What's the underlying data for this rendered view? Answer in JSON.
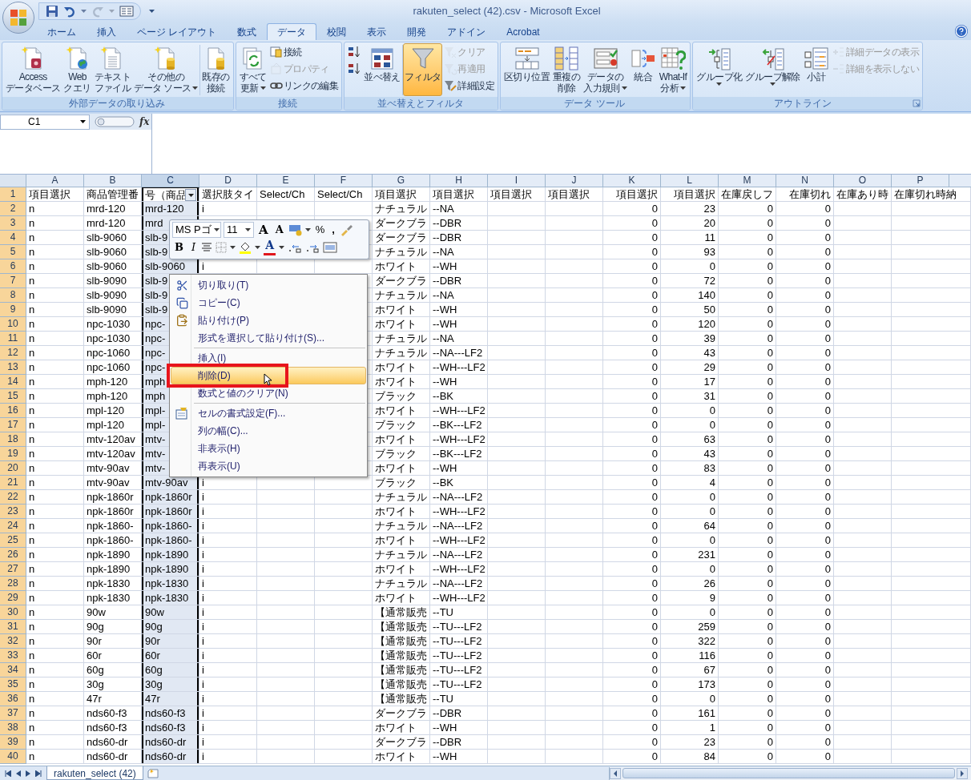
{
  "window": {
    "title": "rakuten_select (42).csv - Microsoft Excel"
  },
  "ribbon_tabs": [
    {
      "label": "ホーム",
      "selected": false
    },
    {
      "label": "挿入",
      "selected": false
    },
    {
      "label": "ページ レイアウト",
      "selected": false
    },
    {
      "label": "数式",
      "selected": false
    },
    {
      "label": "データ",
      "selected": true
    },
    {
      "label": "校閲",
      "selected": false
    },
    {
      "label": "表示",
      "selected": false
    },
    {
      "label": "開発",
      "selected": false
    },
    {
      "label": "アドイン",
      "selected": false
    },
    {
      "label": "Acrobat",
      "selected": false
    }
  ],
  "ribbon_groups": [
    {
      "title": "外部データの取り込み",
      "launcher": false,
      "buttons": [
        {
          "kind": "large",
          "lines": [
            "Access",
            "データベース"
          ],
          "dropdown": false,
          "on": false,
          "disabled": false
        },
        {
          "kind": "large",
          "lines": [
            "Web",
            "クエリ"
          ],
          "dropdown": false,
          "on": false,
          "disabled": false
        },
        {
          "kind": "large",
          "lines": [
            "テキスト",
            "ファイル"
          ],
          "dropdown": false,
          "on": false,
          "disabled": false
        },
        {
          "kind": "large",
          "lines": [
            "その他の",
            "データ ソース"
          ],
          "dropdown": true,
          "on": false,
          "disabled": false
        },
        {
          "kind": "separator"
        },
        {
          "kind": "large",
          "lines": [
            "既存の",
            "接続"
          ],
          "dropdown": false,
          "on": false,
          "disabled": false
        }
      ]
    },
    {
      "title": "接続",
      "launcher": false,
      "buttons": [
        {
          "kind": "large",
          "lines": [
            "すべて",
            "更新"
          ],
          "dropdown": true,
          "on": false,
          "disabled": false
        },
        {
          "kind": "small",
          "label": "接続",
          "dropdown": false,
          "on": false,
          "disabled": false
        },
        {
          "kind": "small",
          "label": "プロパティ",
          "dropdown": false,
          "on": false,
          "disabled": true
        },
        {
          "kind": "small",
          "label": "リンクの編集",
          "dropdown": false,
          "on": false,
          "disabled": false
        }
      ]
    },
    {
      "title": "並べ替えとフィルタ",
      "launcher": false,
      "buttons": [
        {
          "kind": "icon",
          "dropdown": false,
          "on": false,
          "disabled": false
        },
        {
          "kind": "icon",
          "dropdown": false,
          "on": false,
          "disabled": false
        },
        {
          "kind": "large",
          "lines": [
            "並べ替え"
          ],
          "dropdown": false,
          "on": false,
          "disabled": false
        },
        {
          "kind": "separator"
        },
        {
          "kind": "large",
          "lines": [
            "フィルタ"
          ],
          "dropdown": false,
          "on": true,
          "disabled": false
        },
        {
          "kind": "small",
          "label": "クリア",
          "dropdown": false,
          "on": false,
          "disabled": true
        },
        {
          "kind": "small",
          "label": "再適用",
          "dropdown": false,
          "on": false,
          "disabled": true
        },
        {
          "kind": "small",
          "label": "詳細設定",
          "dropdown": false,
          "on": false,
          "disabled": false
        }
      ]
    },
    {
      "title": "データ ツール",
      "launcher": false,
      "buttons": [
        {
          "kind": "large",
          "lines": [
            "区切り位置"
          ],
          "dropdown": false,
          "on": false,
          "disabled": false
        },
        {
          "kind": "large",
          "lines": [
            "重複の",
            "削除"
          ],
          "dropdown": false,
          "on": false,
          "disabled": false
        },
        {
          "kind": "large",
          "lines": [
            "データの",
            "入力規則"
          ],
          "dropdown": true,
          "on": false,
          "disabled": false
        },
        {
          "kind": "large",
          "lines": [
            "統合"
          ],
          "dropdown": false,
          "on": false,
          "disabled": false
        },
        {
          "kind": "large",
          "lines": [
            "What-If",
            "分析"
          ],
          "dropdown": true,
          "on": false,
          "disabled": false
        }
      ]
    },
    {
      "title": "アウトライン",
      "launcher": true,
      "buttons": [
        {
          "kind": "large",
          "lines": [
            "グループ化"
          ],
          "dropdown": true,
          "on": false,
          "disabled": false
        },
        {
          "kind": "large",
          "lines": [
            "グループ解除"
          ],
          "dropdown": true,
          "on": false,
          "disabled": false
        },
        {
          "kind": "large",
          "lines": [
            "小計"
          ],
          "dropdown": false,
          "on": false,
          "disabled": false
        },
        {
          "kind": "small",
          "label": "詳細データの表示",
          "dropdown": false,
          "on": false,
          "disabled": true
        },
        {
          "kind": "small",
          "label": "詳細を表示しない",
          "dropdown": false,
          "on": false,
          "disabled": true
        }
      ]
    }
  ],
  "formula_bar": {
    "name_box": "C1",
    "fx": "fx"
  },
  "sheet": {
    "active_cell_dropdown": true,
    "columns": [
      {
        "label": "A",
        "selected": false
      },
      {
        "label": "B",
        "selected": false
      },
      {
        "label": "C",
        "selected": true
      },
      {
        "label": "D",
        "selected": false
      },
      {
        "label": "E",
        "selected": false
      },
      {
        "label": "F",
        "selected": false
      },
      {
        "label": "G",
        "selected": false
      },
      {
        "label": "H",
        "selected": false
      },
      {
        "label": "I",
        "selected": false
      },
      {
        "label": "J",
        "selected": false
      },
      {
        "label": "K",
        "selected": false
      },
      {
        "label": "L",
        "selected": false
      },
      {
        "label": "M",
        "selected": false
      },
      {
        "label": "N",
        "selected": false
      },
      {
        "label": "O",
        "selected": false
      },
      {
        "label": "P",
        "selected": false
      }
    ],
    "rows": [
      {
        "number": "1",
        "cells": [
          "項目選択",
          "商品管理番",
          "号（商品",
          "選択肢タイ",
          "Select/Ch",
          "Select/Ch",
          "項目選択",
          "項目選択",
          "項目選択",
          "項目選択",
          "項目選択",
          "項目選択",
          "在庫戻しフ",
          "在庫切れ",
          "在庫あり時",
          "在庫切れ時納"
        ]
      },
      {
        "number": "2",
        "cells": [
          "n",
          "mrd-120",
          "mrd-120",
          "i",
          null,
          null,
          "ナチュラル",
          "--NA",
          null,
          null,
          "0",
          "23",
          "0",
          "0",
          null,
          null
        ]
      },
      {
        "number": "3",
        "cells": [
          "n",
          "mrd-120",
          "mrd",
          null,
          null,
          null,
          "ダークブラ",
          "--DBR",
          null,
          null,
          "0",
          "20",
          "0",
          "0",
          null,
          null
        ]
      },
      {
        "number": "4",
        "cells": [
          "n",
          "slb-9060",
          "slb-9",
          null,
          null,
          null,
          "ダークブラ",
          "--DBR",
          null,
          null,
          "0",
          "11",
          "0",
          "0",
          null,
          null
        ]
      },
      {
        "number": "5",
        "cells": [
          "n",
          "slb-9060",
          "slb-9",
          null,
          null,
          null,
          "ナチュラル",
          "--NA",
          null,
          null,
          "0",
          "93",
          "0",
          "0",
          null,
          null
        ]
      },
      {
        "number": "6",
        "cells": [
          "n",
          "slb-9060",
          "slb-9060",
          "i",
          null,
          null,
          "ホワイト",
          "--WH",
          null,
          null,
          "0",
          "0",
          "0",
          "0",
          null,
          null
        ]
      },
      {
        "number": "7",
        "cells": [
          "n",
          "slb-9090",
          "slb-9",
          null,
          null,
          null,
          "ダークブラ",
          "--DBR",
          null,
          null,
          "0",
          "72",
          "0",
          "0",
          null,
          null
        ]
      },
      {
        "number": "8",
        "cells": [
          "n",
          "slb-9090",
          "slb-9",
          null,
          null,
          null,
          "ナチュラル",
          "--NA",
          null,
          null,
          "0",
          "140",
          "0",
          "0",
          null,
          null
        ]
      },
      {
        "number": "9",
        "cells": [
          "n",
          "slb-9090",
          "slb-9",
          null,
          null,
          null,
          "ホワイト",
          "--WH",
          null,
          null,
          "0",
          "50",
          "0",
          "0",
          null,
          null
        ]
      },
      {
        "number": "10",
        "cells": [
          "n",
          "npc-1030",
          "npc-",
          null,
          null,
          null,
          "ホワイト",
          "--WH",
          null,
          null,
          "0",
          "120",
          "0",
          "0",
          null,
          null
        ]
      },
      {
        "number": "11",
        "cells": [
          "n",
          "npc-1030",
          "npc-",
          null,
          null,
          null,
          "ナチュラル",
          "--NA",
          null,
          null,
          "0",
          "39",
          "0",
          "0",
          null,
          null
        ]
      },
      {
        "number": "12",
        "cells": [
          "n",
          "npc-1060",
          "npc-",
          null,
          null,
          null,
          "ナチュラル",
          "--NA---LF2",
          null,
          null,
          "0",
          "43",
          "0",
          "0",
          null,
          null
        ]
      },
      {
        "number": "13",
        "cells": [
          "n",
          "npc-1060",
          "npc-",
          null,
          null,
          null,
          "ホワイト",
          "--WH---LF2",
          null,
          null,
          "0",
          "29",
          "0",
          "0",
          null,
          null
        ]
      },
      {
        "number": "14",
        "cells": [
          "n",
          "mph-120",
          "mph",
          null,
          null,
          null,
          "ホワイト",
          "--WH",
          null,
          null,
          "0",
          "17",
          "0",
          "0",
          null,
          null
        ]
      },
      {
        "number": "15",
        "cells": [
          "n",
          "mph-120",
          "mph",
          null,
          null,
          null,
          "ブラック",
          "--BK",
          null,
          null,
          "0",
          "31",
          "0",
          "0",
          null,
          null
        ]
      },
      {
        "number": "16",
        "cells": [
          "n",
          "mpl-120",
          "mpl-",
          null,
          null,
          null,
          "ホワイト",
          "--WH---LF2",
          null,
          null,
          "0",
          "0",
          "0",
          "0",
          null,
          null
        ]
      },
      {
        "number": "17",
        "cells": [
          "n",
          "mpl-120",
          "mpl-",
          null,
          null,
          null,
          "ブラック",
          "--BK---LF2",
          null,
          null,
          "0",
          "0",
          "0",
          "0",
          null,
          null
        ]
      },
      {
        "number": "18",
        "cells": [
          "n",
          "mtv-120av",
          "mtv-",
          null,
          null,
          null,
          "ホワイト",
          "--WH---LF2",
          null,
          null,
          "0",
          "63",
          "0",
          "0",
          null,
          null
        ]
      },
      {
        "number": "19",
        "cells": [
          "n",
          "mtv-120av",
          "mtv-",
          null,
          null,
          null,
          "ブラック",
          "--BK---LF2",
          null,
          null,
          "0",
          "43",
          "0",
          "0",
          null,
          null
        ]
      },
      {
        "number": "20",
        "cells": [
          "n",
          "mtv-90av",
          "mtv-",
          null,
          null,
          null,
          "ホワイト",
          "--WH",
          null,
          null,
          "0",
          "83",
          "0",
          "0",
          null,
          null
        ]
      },
      {
        "number": "21",
        "cells": [
          "n",
          "mtv-90av",
          "mtv-90av",
          "i",
          null,
          null,
          "ブラック",
          "--BK",
          null,
          null,
          "0",
          "4",
          "0",
          "0",
          null,
          null
        ]
      },
      {
        "number": "22",
        "cells": [
          "n",
          "npk-1860r",
          "npk-1860r",
          "i",
          null,
          null,
          "ナチュラル",
          "--NA---LF2",
          null,
          null,
          "0",
          "0",
          "0",
          "0",
          null,
          null
        ]
      },
      {
        "number": "23",
        "cells": [
          "n",
          "npk-1860r",
          "npk-1860r",
          "i",
          null,
          null,
          "ホワイト",
          "--WH---LF2",
          null,
          null,
          "0",
          "0",
          "0",
          "0",
          null,
          null
        ]
      },
      {
        "number": "24",
        "cells": [
          "n",
          "npk-1860-",
          "npk-1860-",
          "i",
          null,
          null,
          "ナチュラル",
          "--NA---LF2",
          null,
          null,
          "0",
          "64",
          "0",
          "0",
          null,
          null
        ]
      },
      {
        "number": "25",
        "cells": [
          "n",
          "npk-1860-",
          "npk-1860-",
          "i",
          null,
          null,
          "ホワイト",
          "--WH---LF2",
          null,
          null,
          "0",
          "0",
          "0",
          "0",
          null,
          null
        ]
      },
      {
        "number": "26",
        "cells": [
          "n",
          "npk-1890",
          "npk-1890",
          "i",
          null,
          null,
          "ナチュラル",
          "--NA---LF2",
          null,
          null,
          "0",
          "231",
          "0",
          "0",
          null,
          null
        ]
      },
      {
        "number": "27",
        "cells": [
          "n",
          "npk-1890",
          "npk-1890",
          "i",
          null,
          null,
          "ホワイト",
          "--WH---LF2",
          null,
          null,
          "0",
          "0",
          "0",
          "0",
          null,
          null
        ]
      },
      {
        "number": "28",
        "cells": [
          "n",
          "npk-1830",
          "npk-1830",
          "i",
          null,
          null,
          "ナチュラル",
          "--NA---LF2",
          null,
          null,
          "0",
          "26",
          "0",
          "0",
          null,
          null
        ]
      },
      {
        "number": "29",
        "cells": [
          "n",
          "npk-1830",
          "npk-1830",
          "i",
          null,
          null,
          "ホワイト",
          "--WH---LF2",
          null,
          null,
          "0",
          "9",
          "0",
          "0",
          null,
          null
        ]
      },
      {
        "number": "30",
        "cells": [
          "n",
          "90w",
          "90w",
          "i",
          null,
          null,
          "【通常販売",
          "--TU",
          null,
          null,
          "0",
          "0",
          "0",
          "0",
          null,
          null
        ]
      },
      {
        "number": "31",
        "cells": [
          "n",
          "90g",
          "90g",
          "i",
          null,
          null,
          "【通常販売",
          "--TU---LF2",
          null,
          null,
          "0",
          "259",
          "0",
          "0",
          null,
          null
        ]
      },
      {
        "number": "32",
        "cells": [
          "n",
          "90r",
          "90r",
          "i",
          null,
          null,
          "【通常販売",
          "--TU---LF2",
          null,
          null,
          "0",
          "322",
          "0",
          "0",
          null,
          null
        ]
      },
      {
        "number": "33",
        "cells": [
          "n",
          "60r",
          "60r",
          "i",
          null,
          null,
          "【通常販売",
          "--TU---LF2",
          null,
          null,
          "0",
          "116",
          "0",
          "0",
          null,
          null
        ]
      },
      {
        "number": "34",
        "cells": [
          "n",
          "60g",
          "60g",
          "i",
          null,
          null,
          "【通常販売",
          "--TU---LF2",
          null,
          null,
          "0",
          "67",
          "0",
          "0",
          null,
          null
        ]
      },
      {
        "number": "35",
        "cells": [
          "n",
          "30g",
          "30g",
          "i",
          null,
          null,
          "【通常販売",
          "--TU---LF2",
          null,
          null,
          "0",
          "173",
          "0",
          "0",
          null,
          null
        ]
      },
      {
        "number": "36",
        "cells": [
          "n",
          "47r",
          "47r",
          "i",
          null,
          null,
          "【通常販売",
          "--TU",
          null,
          null,
          "0",
          "0",
          "0",
          "0",
          null,
          null
        ]
      },
      {
        "number": "37",
        "cells": [
          "n",
          "nds60-f3",
          "nds60-f3",
          "i",
          null,
          null,
          "ダークブラ",
          "--DBR",
          null,
          null,
          "0",
          "161",
          "0",
          "0",
          null,
          null
        ]
      },
      {
        "number": "38",
        "cells": [
          "n",
          "nds60-f3",
          "nds60-f3",
          "i",
          null,
          null,
          "ホワイト",
          "--WH",
          null,
          null,
          "0",
          "1",
          "0",
          "0",
          null,
          null
        ]
      },
      {
        "number": "39",
        "cells": [
          "n",
          "nds60-dr",
          "nds60-dr",
          "i",
          null,
          null,
          "ダークブラ",
          "--DBR",
          null,
          null,
          "0",
          "23",
          "0",
          "0",
          null,
          null
        ]
      },
      {
        "number": "40",
        "cells": [
          "n",
          "nds60-dr",
          "nds60-dr",
          "i",
          null,
          null,
          "ホワイト",
          "--WH",
          null,
          null,
          "0",
          "84",
          "0",
          "0",
          null,
          null
        ]
      }
    ]
  },
  "mini_toolbar": {
    "font": "MS Pゴ",
    "size": "11",
    "grow_font": "A",
    "shrink_font": "A",
    "percent": "%",
    "comma": ",",
    "bold": "B",
    "italic": "I",
    "font_color": "A"
  },
  "context_menu": {
    "callout": true,
    "items": [
      {
        "kind": "item",
        "label": "切り取り(T)",
        "selected": false
      },
      {
        "kind": "item",
        "label": "コピー(C)",
        "selected": false
      },
      {
        "kind": "item",
        "label": "貼り付け(P)",
        "selected": false
      },
      {
        "kind": "item",
        "label": "形式を選択して貼り付け(S)...",
        "selected": false
      },
      {
        "kind": "separator"
      },
      {
        "kind": "item",
        "label": "挿入(I)",
        "selected": false
      },
      {
        "kind": "item",
        "label": "削除(D)",
        "selected": true
      },
      {
        "kind": "item",
        "label": "数式と値のクリア(N)",
        "selected": false
      },
      {
        "kind": "separator"
      },
      {
        "kind": "item",
        "label": "セルの書式設定(F)...",
        "selected": false
      },
      {
        "kind": "item",
        "label": "列の幅(C)...",
        "selected": false
      },
      {
        "kind": "item",
        "label": "非表示(H)",
        "selected": false
      },
      {
        "kind": "item",
        "label": "再表示(U)",
        "selected": false
      }
    ]
  },
  "sheet_tabs": [
    {
      "label": "rakuten_select (42)",
      "selected": true
    }
  ]
}
